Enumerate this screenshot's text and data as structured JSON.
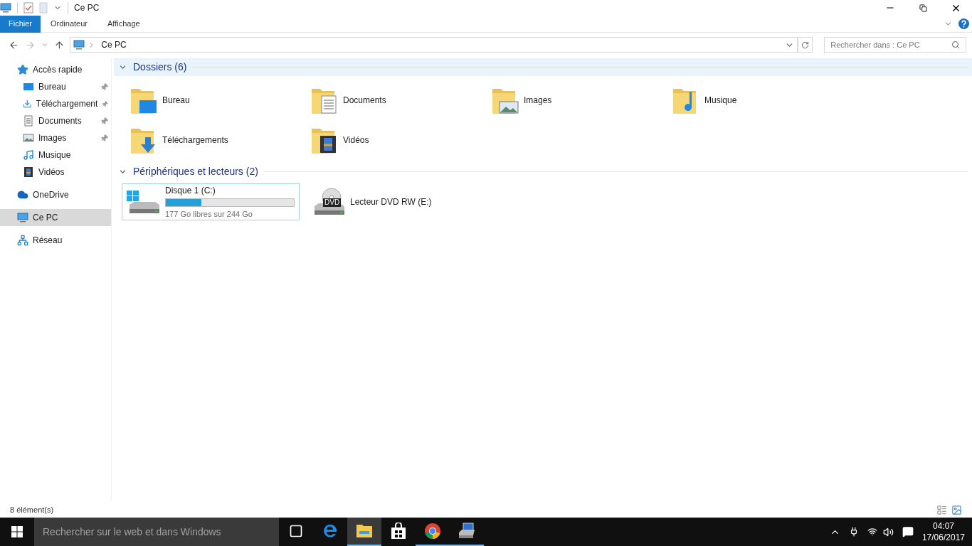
{
  "window": {
    "title": "Ce PC"
  },
  "ribbon": {
    "tabs": [
      {
        "label": "Fichier",
        "selected": true
      },
      {
        "label": "Ordinateur",
        "selected": false
      },
      {
        "label": "Affichage",
        "selected": false
      }
    ]
  },
  "address": {
    "path": "Ce PC",
    "search_placeholder": "Rechercher dans : Ce PC"
  },
  "sidebar": {
    "items": [
      {
        "label": "Accès rapide",
        "selected": false,
        "children": [
          {
            "label": "Bureau",
            "pinned": true,
            "selected": false
          },
          {
            "label": "Téléchargement",
            "pinned": true,
            "selected": false
          },
          {
            "label": "Documents",
            "pinned": true,
            "selected": false
          },
          {
            "label": "Images",
            "pinned": true,
            "selected": false
          },
          {
            "label": "Musique",
            "pinned": false,
            "selected": false
          },
          {
            "label": "Vidéos",
            "pinned": false,
            "selected": false
          }
        ]
      },
      {
        "label": "OneDrive",
        "selected": false
      },
      {
        "label": "Ce PC",
        "selected": true
      },
      {
        "label": "Réseau",
        "selected": false
      }
    ]
  },
  "groups": [
    {
      "title": "Dossiers (6)",
      "expanded": true,
      "kind": "folders",
      "items": [
        {
          "label": "Bureau"
        },
        {
          "label": "Documents"
        },
        {
          "label": "Images"
        },
        {
          "label": "Musique"
        },
        {
          "label": "Téléchargements"
        },
        {
          "label": "Vidéos"
        }
      ]
    },
    {
      "title": "Périphériques et lecteurs (2)",
      "expanded": true,
      "kind": "drives",
      "items": [
        {
          "label": "Disque 1 (C:)",
          "kind": "disk",
          "selected": true,
          "level": 0.28,
          "detail": "177 Go libres sur 244 Go"
        },
        {
          "label": "Lecteur DVD RW (E:)",
          "kind": "dvd",
          "selected": false,
          "badge": "DVD"
        }
      ]
    }
  ],
  "status_bar": {
    "count": "8 élément(s)"
  },
  "taskbar": {
    "search_placeholder": "Rechercher sur le web et dans Windows",
    "apps": [
      {
        "selected": false,
        "running": false
      },
      {
        "selected": false,
        "running": false
      },
      {
        "selected": true,
        "running": true
      },
      {
        "selected": false,
        "running": false
      },
      {
        "selected": false,
        "running": true
      },
      {
        "selected": false,
        "running": true
      }
    ],
    "time": "04:07",
    "date": "17/06/2017"
  }
}
